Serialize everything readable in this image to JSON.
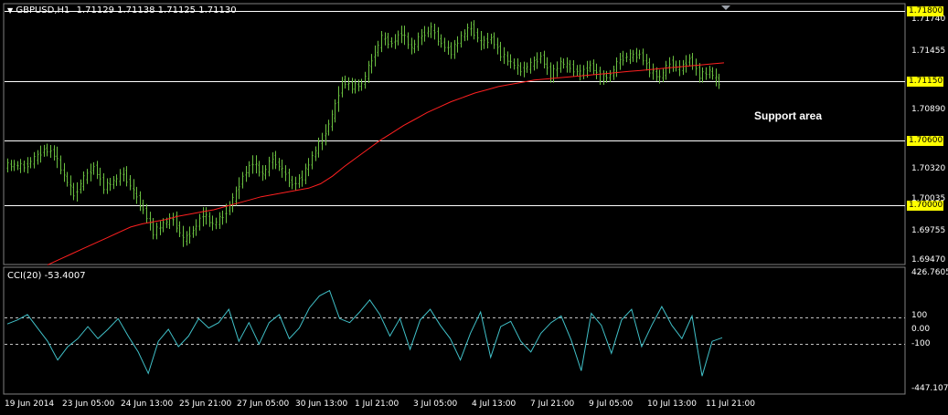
{
  "header": {
    "symbol": "GBPUSD,H1",
    "ohlc": "1.71129 1.71138 1.71125 1.71130"
  },
  "indicator": {
    "label": "CCI(20) -53.4007",
    "axis": [
      "426.7605",
      "100",
      "0.00",
      "-100",
      "-447.1073"
    ]
  },
  "price_axis": [
    "1.71740",
    "1.71455",
    "1.70890",
    "1.70320",
    "1.70035",
    "1.69755",
    "1.69470"
  ],
  "levels": [
    {
      "price": 1.718,
      "label": "1.71800"
    },
    {
      "price": 1.7115,
      "label": "1.71150"
    },
    {
      "price": 1.706,
      "label": "1.70600"
    },
    {
      "price": 1.7,
      "label": "1.70000"
    }
  ],
  "annotation": "Support area",
  "dates": [
    "19 Jun 2014",
    "23 Jun 05:00",
    "24 Jun 13:00",
    "25 Jun 21:00",
    "27 Jun 05:00",
    "30 Jun 13:00",
    "1 Jul 21:00",
    "3 Jul 05:00",
    "4 Jul 13:00",
    "7 Jul 21:00",
    "9 Jul 05:00",
    "10 Jul 13:00",
    "11 Jul 21:00"
  ],
  "chart_data": {
    "type": "candlestick",
    "price_range": [
      1.6947,
      1.718
    ],
    "cci_range": [
      -447.1073,
      426.7605
    ],
    "close": [
      1.7037,
      1.7036,
      1.7043,
      1.7052,
      1.7048,
      1.7027,
      1.701,
      1.7025,
      1.7036,
      1.7017,
      1.7022,
      1.703,
      1.7012,
      1.6996,
      1.6975,
      1.6983,
      1.6988,
      1.6968,
      1.6977,
      1.6992,
      1.6982,
      1.699,
      1.7005,
      1.7027,
      1.704,
      1.7028,
      1.7044,
      1.7032,
      1.7019,
      1.7026,
      1.7045,
      1.7062,
      1.7082,
      1.7115,
      1.711,
      1.7112,
      1.7135,
      1.7155,
      1.715,
      1.716,
      1.7145,
      1.7158,
      1.7163,
      1.715,
      1.7142,
      1.7156,
      1.7165,
      1.715,
      1.7155,
      1.714,
      1.7132,
      1.7125,
      1.713,
      1.7138,
      1.712,
      1.7132,
      1.7128,
      1.7122,
      1.713,
      1.7118,
      1.712,
      1.7136,
      1.7138,
      1.714,
      1.7125,
      1.7118,
      1.7132,
      1.7126,
      1.7136,
      1.712,
      1.7124,
      1.7113
    ],
    "ma": [
      1.6945,
      1.695,
      1.6955,
      1.696,
      1.6965,
      1.697,
      1.6975,
      1.698,
      1.6983,
      1.6985,
      1.6987,
      1.699,
      1.6992,
      1.6994,
      1.6996,
      1.6999,
      1.7002,
      1.7005,
      1.7008,
      1.701,
      1.7012,
      1.7014,
      1.7016,
      1.702,
      1.7027,
      1.7036,
      1.7044,
      1.7052,
      1.706,
      1.7067,
      1.7074,
      1.708,
      1.7086,
      1.7091,
      1.7096,
      1.71,
      1.7104,
      1.7107,
      1.711,
      1.7112,
      1.7114,
      1.7116,
      1.7117,
      1.7118,
      1.7119,
      1.712,
      1.7121,
      1.7122,
      1.7123,
      1.7124,
      1.7125,
      1.7126,
      1.7127,
      1.7128,
      1.7129,
      1.713,
      1.7131,
      1.7132
    ],
    "cci": [
      50,
      80,
      120,
      20,
      -80,
      -220,
      -120,
      -60,
      30,
      -60,
      10,
      90,
      -40,
      -160,
      -320,
      -80,
      10,
      -120,
      -40,
      90,
      20,
      60,
      160,
      -80,
      60,
      -100,
      60,
      120,
      -60,
      20,
      170,
      260,
      300,
      90,
      60,
      140,
      230,
      120,
      -40,
      90,
      -140,
      80,
      160,
      40,
      -60,
      -220,
      -20,
      140,
      -200,
      30,
      70,
      -80,
      -160,
      -20,
      60,
      110,
      -70,
      -300,
      130,
      40,
      -170,
      80,
      160,
      -120,
      40,
      180,
      40,
      -60,
      110,
      -340,
      -80,
      -53
    ]
  },
  "colors": {
    "background": "#000000",
    "candle": "#6abf40",
    "moving_average": "#ff2020",
    "cci_line": "#40c0c8",
    "level_line": "#ffffff",
    "level_box": "#ffff00"
  }
}
